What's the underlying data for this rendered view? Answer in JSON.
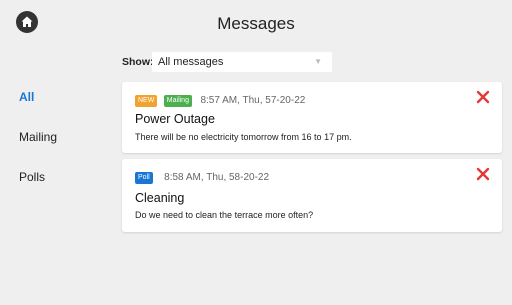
{
  "header": {
    "title": "Messages"
  },
  "filter": {
    "label": "Show:",
    "selected": "All messages"
  },
  "sidebar": {
    "items": [
      {
        "label": "All",
        "active": true
      },
      {
        "label": "Mailing",
        "active": false
      },
      {
        "label": "Polls",
        "active": false
      }
    ]
  },
  "messages": [
    {
      "badges": [
        {
          "label": "NEW",
          "color": "#f0a330"
        },
        {
          "label": "Mailing",
          "color": "#4caf50"
        }
      ],
      "time": "8:57 AM, Thu, 57-20-22",
      "title": "Power Outage",
      "body": "There will be no electricity tomorrow from 16 to 17 pm."
    },
    {
      "badges": [
        {
          "label": "Poll",
          "color": "#1976d2"
        }
      ],
      "time": "8:58 AM, Thu, 58-20-22",
      "title": "Cleaning",
      "body": "Do we need to clean the terrace more often?"
    }
  ],
  "colors": {
    "accent": "#1976d2",
    "delete": "#e53935",
    "background": "#efefef"
  }
}
